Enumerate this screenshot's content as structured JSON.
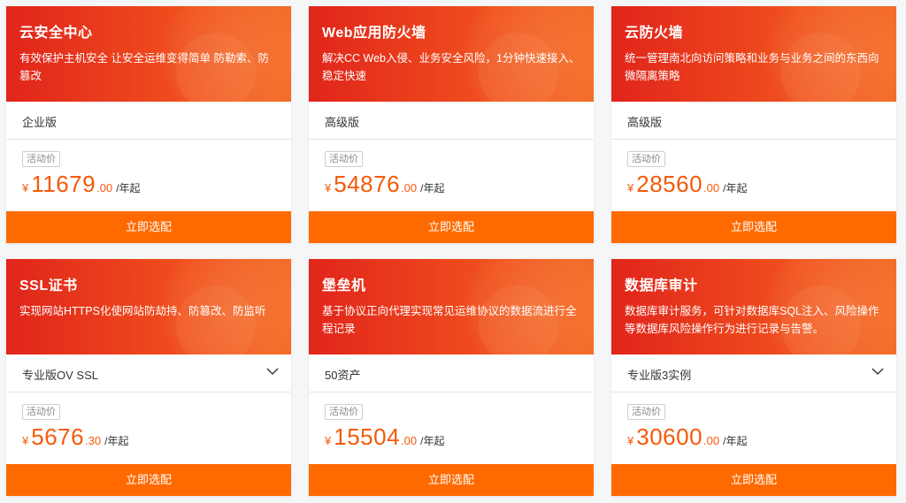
{
  "cards": [
    {
      "title": "云安全中心",
      "desc": "有效保护主机安全 让安全运维变得简单 防勒索、防篡改",
      "edition": "企业版",
      "tag": "活动价",
      "yen": "¥",
      "price_int": "11679",
      "price_dec": ".00",
      "unit": "/年起",
      "buy": "立即选配",
      "has_dropdown": false
    },
    {
      "title": "Web应用防火墙",
      "desc": "解决CC Web入侵、业务安全风险，1分钟快速接入、稳定快速",
      "edition": "高级版",
      "tag": "活动价",
      "yen": "¥",
      "price_int": "54876",
      "price_dec": ".00",
      "unit": "/年起",
      "buy": "立即选配",
      "has_dropdown": false
    },
    {
      "title": "云防火墙",
      "desc": "统一管理南北向访问策略和业务与业务之间的东西向微隔离策略",
      "edition": "高级版",
      "tag": "活动价",
      "yen": "¥",
      "price_int": "28560",
      "price_dec": ".00",
      "unit": "/年起",
      "buy": "立即选配",
      "has_dropdown": false
    },
    {
      "title": "SSL证书",
      "desc": "实现网站HTTPS化使网站防劫持、防篡改、防监听",
      "edition": "专业版OV SSL",
      "tag": "活动价",
      "yen": "¥",
      "price_int": "5676",
      "price_dec": ".30",
      "unit": "/年起",
      "buy": "立即选配",
      "has_dropdown": true
    },
    {
      "title": "堡垒机",
      "desc": "基于协议正向代理实现常见运维协议的数据流进行全程记录",
      "edition": "50资产",
      "tag": "活动价",
      "yen": "¥",
      "price_int": "15504",
      "price_dec": ".00",
      "unit": "/年起",
      "buy": "立即选配",
      "has_dropdown": false
    },
    {
      "title": "数据库审计",
      "desc": "数据库审计服务，可针对数据库SQL注入、风险操作等数据库风险操作行为进行记录与告警。",
      "edition": "专业版3实例",
      "tag": "活动价",
      "yen": "¥",
      "price_int": "30600",
      "price_dec": ".00",
      "unit": "/年起",
      "buy": "立即选配",
      "has_dropdown": true
    }
  ],
  "colors": {
    "header_start": "#e1251b",
    "header_end": "#f36b26",
    "price": "#f45a0a",
    "button": "#ff6a00"
  },
  "icons": {
    "dropdown": "chevron-down-icon"
  }
}
